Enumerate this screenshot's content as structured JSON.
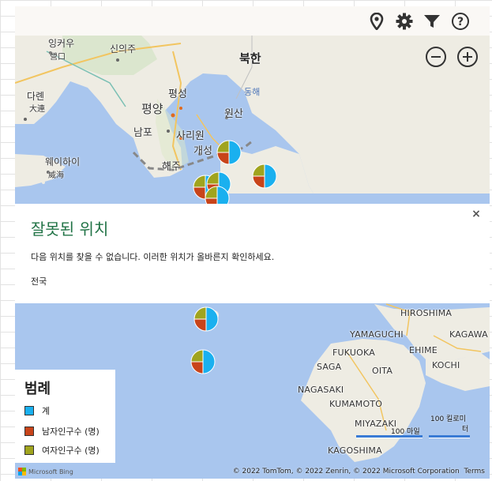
{
  "toolbar": {
    "icons": [
      "location-pin-icon",
      "gear-icon",
      "filter-icon",
      "help-icon"
    ]
  },
  "zoom": {
    "out_symbol": "−",
    "in_symbol": "+"
  },
  "labels": {
    "yingkou": "잉커우",
    "yingkou_sub": "營口",
    "sinuiju": "신의주",
    "north_korea": "북한",
    "dalian": "다롄",
    "dalian_sub": "大連",
    "pyongsong": "평성",
    "pyongyang": "평양",
    "east_sea": "동해",
    "wonsan": "원산",
    "nampo": "남포",
    "sariwon": "사리원",
    "kaesong": "개성",
    "weihai": "웨이하이",
    "weihai_sub": "威海",
    "haeju": "해주",
    "hiroshima": "HIROSHIMA",
    "yamaguchi": "YAMAGUCHI",
    "ehime": "EHIME",
    "kagawa": "KAGAWA",
    "fukuoka": "FUKUOKA",
    "saga": "SAGA",
    "oita": "OITA",
    "kochi": "KOCHI",
    "nagasaki": "NAGASAKI",
    "kumamoto": "KUMAMOTO",
    "miyazaki": "MIYAZAKI",
    "kagoshima": "KAGOSHIMA"
  },
  "dialog": {
    "title": "잘못된 위치",
    "message": "다음 위치를 찾을 수 없습니다. 이러한 위치가 올바른지 확인하세요.",
    "item": "전국",
    "close": "×"
  },
  "legend": {
    "title": "범례",
    "items": [
      {
        "label": "계",
        "color": "#1ab0ef"
      },
      {
        "label": "남자인구수 (명)",
        "color": "#c8441a"
      },
      {
        "label": "여자인구수 (명)",
        "color": "#a0a41e"
      }
    ]
  },
  "scale": {
    "miles": "100 마일",
    "km_line1": "100 킬로미",
    "km_line2": "터"
  },
  "footer": {
    "copyright": "© 2022 TomTom, © 2022 Zenrin, © 2022 Microsoft Corporation",
    "terms": "Terms",
    "bing": "Microsoft Bing"
  },
  "colors": {
    "accent": "#217346",
    "water": "#a9c6ee",
    "land": "#eeece3",
    "series_total": "#1ab0ef",
    "series_male": "#c8441a",
    "series_female": "#a0a41e"
  }
}
